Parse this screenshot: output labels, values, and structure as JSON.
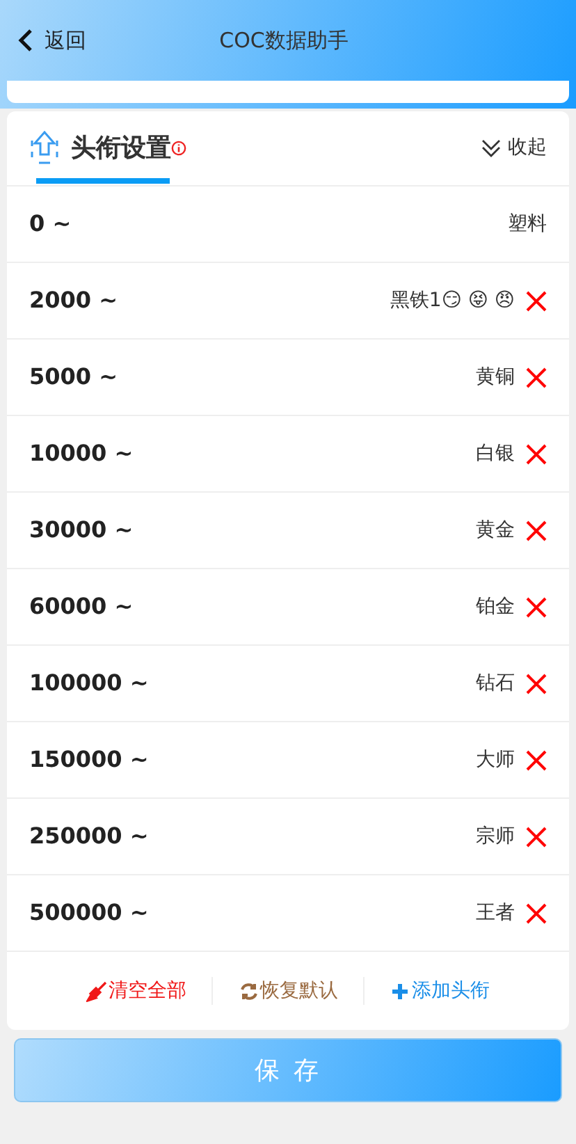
{
  "header": {
    "back": "返回",
    "title": "COC数据助手"
  },
  "section": {
    "title": "头衔设置",
    "collapse": "收起"
  },
  "tiers": [
    {
      "score": "0 ~",
      "name": "塑料",
      "removable": false
    },
    {
      "score": "2000 ~",
      "name": "黑铁1😏 😝 😠",
      "removable": true
    },
    {
      "score": "5000 ~",
      "name": "黄铜",
      "removable": true
    },
    {
      "score": "10000 ~",
      "name": "白银",
      "removable": true
    },
    {
      "score": "30000 ~",
      "name": "黄金",
      "removable": true
    },
    {
      "score": "60000 ~",
      "name": "铂金",
      "removable": true
    },
    {
      "score": "100000 ~",
      "name": "钻石",
      "removable": true
    },
    {
      "score": "150000 ~",
      "name": "大师",
      "removable": true
    },
    {
      "score": "250000 ~",
      "name": "宗师",
      "removable": true
    },
    {
      "score": "500000 ~",
      "name": "王者",
      "removable": true
    }
  ],
  "actions": [
    {
      "kind": "clear",
      "label": "清空全部"
    },
    {
      "kind": "reset",
      "label": "恢复默认"
    },
    {
      "kind": "add",
      "label": "添加头衔"
    }
  ],
  "save": "保 存"
}
